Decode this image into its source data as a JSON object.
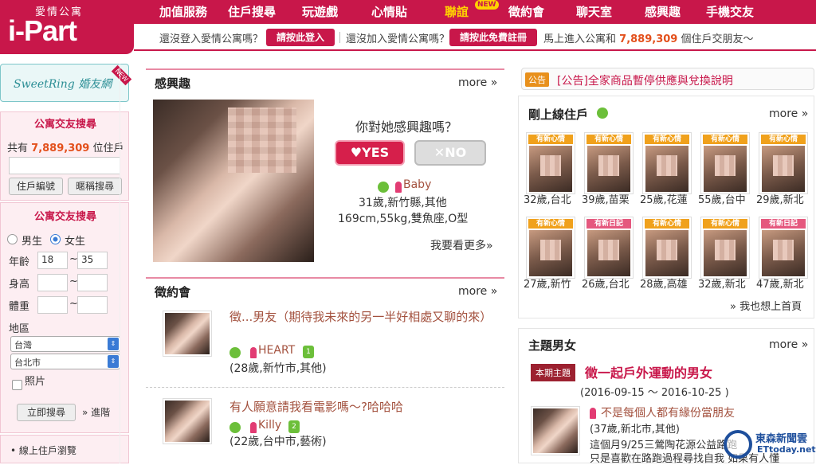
{
  "header": {
    "logo_sub": "愛情公寓",
    "logo_main": "i-Part",
    "nav": [
      "加值服務",
      "住戶搜尋",
      "玩遊戲",
      "心情貼",
      "聯誼",
      "徵約會",
      "聊天室",
      "感興趣",
      "手機交友"
    ],
    "nav_new_badge": "NEW",
    "login_prompt": "還沒登入愛情公寓嗎？",
    "login_button": "請按此登入",
    "register_prompt": "還沒加入愛情公寓嗎？",
    "register_button": "請按此免費註冊",
    "join_prefix": "馬上進入公寓和",
    "join_count": "7,889,309",
    "join_suffix": "個住戶交朋友～"
  },
  "sidebar": {
    "sweetring": "SweetRing 婚友網",
    "new_badge": "NEW",
    "search_title": "公寓交友搜尋",
    "total_prefix": "共有",
    "total_count": "7,889,309",
    "total_suffix": "位住戶",
    "id_button": "住戶編號",
    "nick_button": "暱稱搜尋",
    "filter_title": "公寓交友搜尋",
    "male": "男生",
    "female": "女生",
    "age_label": "年齡",
    "age_from": "18",
    "age_to": "35",
    "height_label": "身高",
    "weight_label": "體重",
    "tilde": "~",
    "region_label": "地區",
    "region_country": "台灣",
    "region_city": "台北市",
    "photo_label": "照片",
    "search_now": "立即搜尋",
    "advanced": "» 進階",
    "online_link": "線上住戶瀏覽"
  },
  "interest": {
    "title": "感興趣",
    "more": "more »",
    "question": "你對她感興趣嗎？",
    "yes": "YES",
    "no": "NO",
    "name": "Baby",
    "info1": "31歲,新竹縣,其他",
    "info2": "169cm,55kg,雙魚座,O型",
    "see_more": "我要看更多»"
  },
  "dating": {
    "title": "徵約會",
    "more": "more »",
    "posts": [
      {
        "text": "徵...男友（期待我未來的另一半好相處又聊的來）",
        "name": "HEART",
        "level": "1",
        "info": "(28歲,新竹市,其他)"
      },
      {
        "text": "有人願意請我看電影嗎～?哈哈哈",
        "name": "Killy",
        "level": "2",
        "info": "(22歲,台中市,藝術)"
      }
    ]
  },
  "announce": {
    "tag": "公告",
    "text": "[公告]全家商品暫停供應與兌換說明"
  },
  "online": {
    "title": "剛上線住戶",
    "more": "more »",
    "cards": [
      {
        "tag": "有新心情",
        "caption": "32歲,台北",
        "color": "#f0a11c"
      },
      {
        "tag": "有新心情",
        "caption": "39歲,苗栗",
        "color": "#f0a11c"
      },
      {
        "tag": "有新心情",
        "caption": "25歲,花蓮",
        "color": "#f0a11c"
      },
      {
        "tag": "有新心情",
        "caption": "55歲,台中",
        "color": "#f0a11c"
      },
      {
        "tag": "有新心情",
        "caption": "29歲,新北",
        "color": "#f0a11c"
      },
      {
        "tag": "有新心情",
        "caption": "27歲,新竹",
        "color": "#f0a11c"
      },
      {
        "tag": "有新日記",
        "caption": "26歲,台北",
        "color": "#e5587e"
      },
      {
        "tag": "有新心情",
        "caption": "28歲,高雄",
        "color": "#f0a11c"
      },
      {
        "tag": "有新心情",
        "caption": "32歲,新北",
        "color": "#f0a11c"
      },
      {
        "tag": "有新日記",
        "caption": "47歲,新北",
        "color": "#e5587e"
      }
    ],
    "front_page": "» 我也想上首頁"
  },
  "topic": {
    "title": "主題男女",
    "more": "more »",
    "badge": "本期主題",
    "headline": "徵一起戶外運動的男女",
    "dates": "(2016-09-15 ～ 2016-10-25 )",
    "post_title": "不是每個人都有緣份當朋友",
    "post_info": "(37歲,新北市,其他)",
    "post_body": "這個月9/25三鶯陶花源公益路跑",
    "post_body2": "只是喜歡在路跑過程尋找自我 如果有人懂"
  },
  "watermark": {
    "cn": "東森新聞雲",
    "en": "ETtoday.net"
  }
}
